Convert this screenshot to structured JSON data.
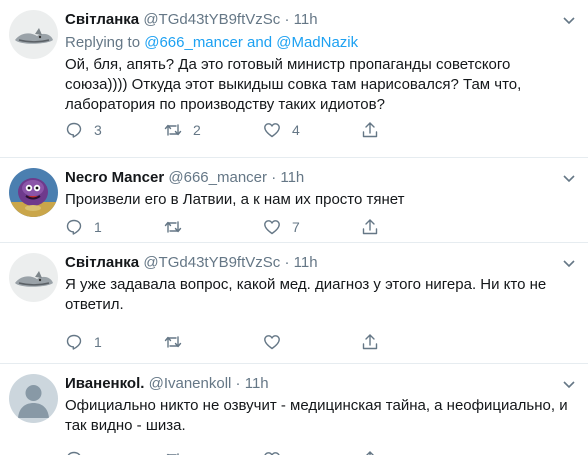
{
  "tweets": [
    {
      "name": "Світланка",
      "handle": "@TGd43tYB9ftVzSc",
      "dot": "·",
      "time": "11h",
      "reply_prefix": "Replying to",
      "reply_user1": "@666_mancer",
      "reply_and": "and",
      "reply_user2": "@MadNazik",
      "line1": "Ой, бля, апять? Да это готовый министр пропаганды советского",
      "line2": "союза))))  Откуда этот выкидыш совка там нарисовался? Там что,",
      "line3": "лаборатория по производству таких идиотов?",
      "replies": "3",
      "retweets": "2",
      "likes": "4"
    },
    {
      "name": "Necro Mancer",
      "handle": "@666_mancer",
      "dot": "·",
      "time": "11h",
      "line1": "Произвели его в Латвии, а к нам их просто тянет",
      "replies": "1",
      "retweets": "",
      "likes": "7"
    },
    {
      "name": "Світланка",
      "handle": "@TGd43tYB9ftVzSc",
      "dot": "·",
      "time": "11h",
      "line1": "Я уже задавала вопрос, какой мед. диагноз у этого нигера. Ни кто не",
      "line2": "ответил.",
      "replies": "1",
      "retweets": "",
      "likes": ""
    },
    {
      "name": "Иваненкоl.",
      "handle": "@Ivanenkoll",
      "dot": "·",
      "time": "11h",
      "line1": "Официально никто не озвучит - медицинская тайна, а неофициально, и",
      "line2": "так видно - шиза."
    }
  ],
  "icons": {
    "reply": "reply-icon",
    "retweet": "retweet-icon",
    "like": "heart-icon",
    "share": "share-icon",
    "caret": "chevron-down-icon"
  },
  "colors": {
    "link": "#1da1f2",
    "muted": "#657786",
    "text": "#14171a",
    "divider": "#e6ecf0"
  }
}
